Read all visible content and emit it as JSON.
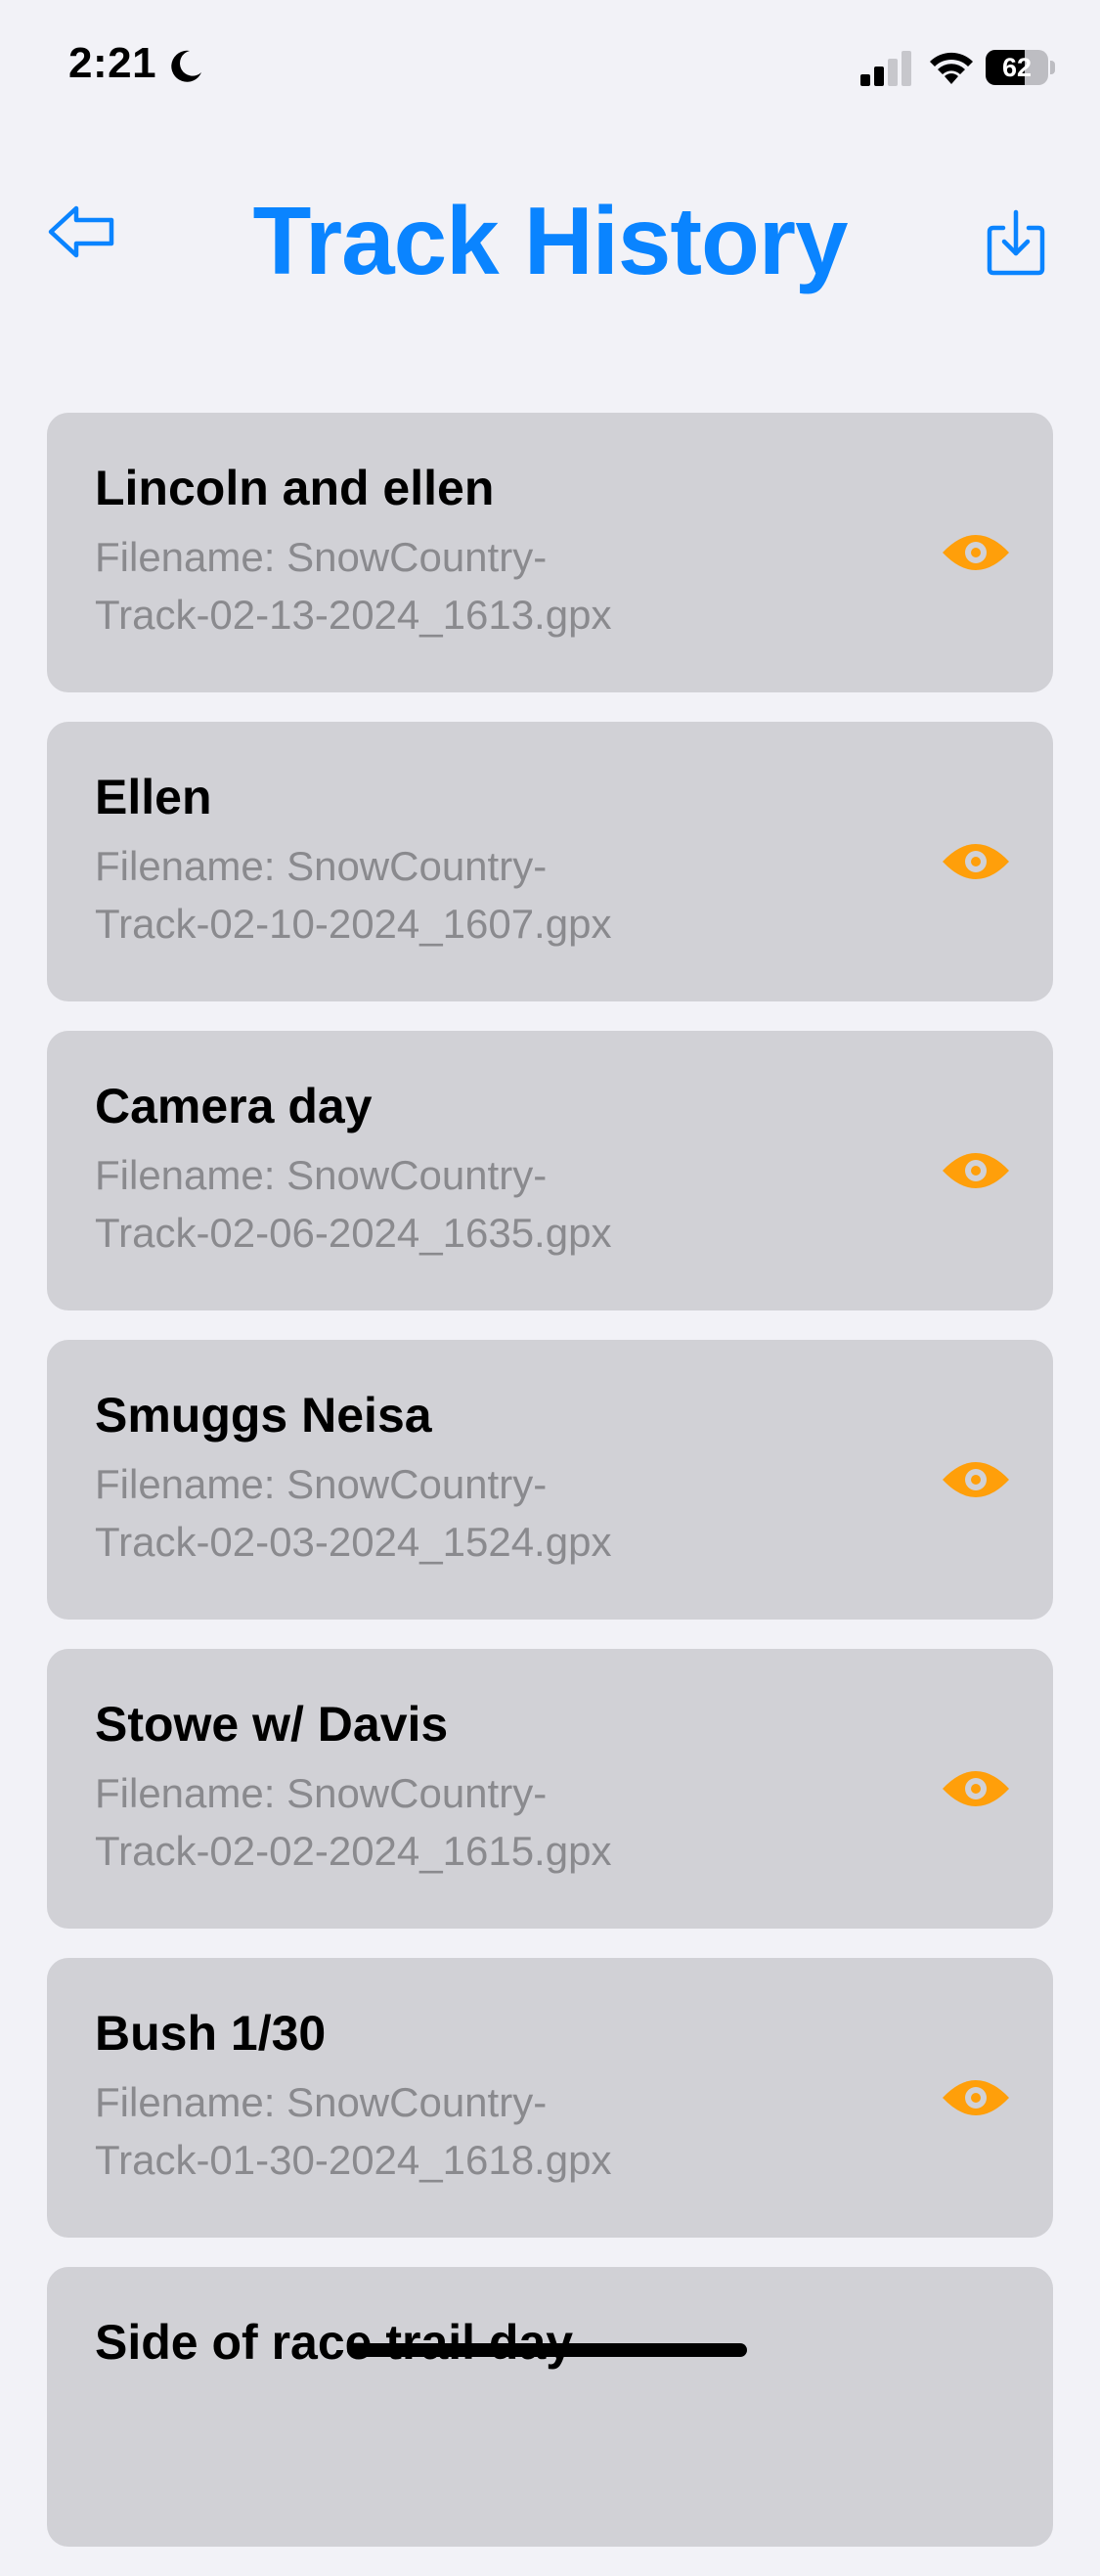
{
  "status_bar": {
    "time": "2:21",
    "battery_level": "62",
    "icons": [
      "moon-icon",
      "signal-icon",
      "wifi-icon",
      "battery-icon"
    ]
  },
  "header": {
    "title": "Track History",
    "back_icon": "back-arrow-icon",
    "export_icon": "download-icon"
  },
  "colors": {
    "accent": "#0a84ff",
    "eye": "#ff9f0a",
    "card": "#d1d1d6",
    "background": "#f2f2f7",
    "secondary_text": "#8a8a8e"
  },
  "tracks": [
    {
      "name": "Lincoln and ellen",
      "file_line1": "Filename: SnowCountry-",
      "file_line2": "Track-02-13-2024_1613.gpx"
    },
    {
      "name": "Ellen",
      "file_line1": "Filename: SnowCountry-",
      "file_line2": "Track-02-10-2024_1607.gpx"
    },
    {
      "name": "Camera day",
      "file_line1": "Filename: SnowCountry-",
      "file_line2": "Track-02-06-2024_1635.gpx"
    },
    {
      "name": "Smuggs Neisa",
      "file_line1": "Filename: SnowCountry-",
      "file_line2": "Track-02-03-2024_1524.gpx"
    },
    {
      "name": "Stowe w/ Davis",
      "file_line1": "Filename: SnowCountry-",
      "file_line2": "Track-02-02-2024_1615.gpx"
    },
    {
      "name": "Bush 1/30",
      "file_line1": "Filename: SnowCountry-",
      "file_line2": "Track-01-30-2024_1618.gpx"
    },
    {
      "name": "Side of race trail day",
      "file_line1": "",
      "file_line2": ""
    }
  ]
}
